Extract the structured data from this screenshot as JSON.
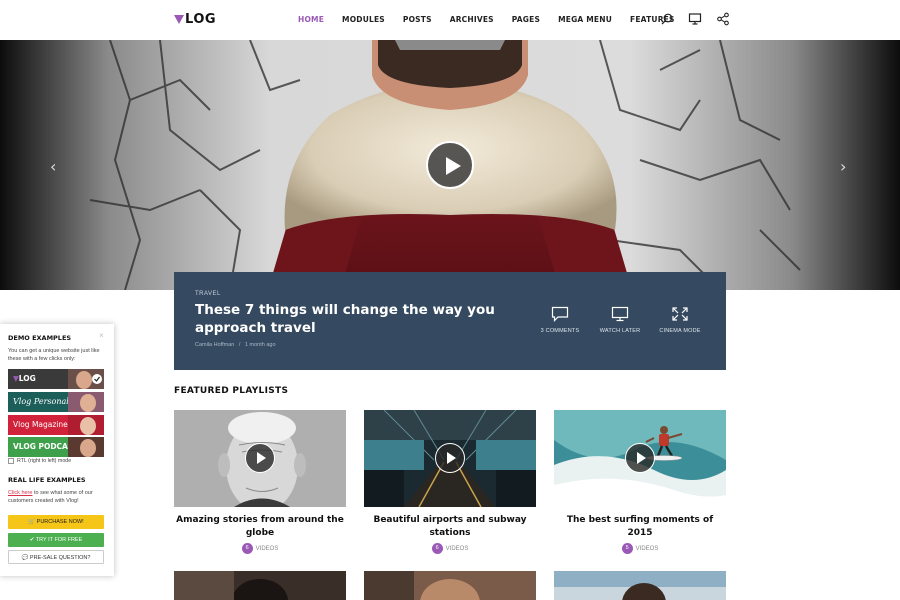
{
  "brand": {
    "logo": "LOG",
    "accent": "#9b59b6"
  },
  "nav": {
    "items": [
      "HOME",
      "MODULES",
      "POSTS",
      "ARCHIVES",
      "PAGES",
      "MEGA MENU",
      "FEATURES"
    ],
    "active": "HOME"
  },
  "header_icons": [
    "search-icon",
    "monitor-icon",
    "share-icon"
  ],
  "hero": {
    "prev": "‹",
    "next": "›"
  },
  "featured_post": {
    "category": "TRAVEL",
    "title": "These 7 things will change the way you approach travel",
    "author": "Camila Hoffman",
    "separator": "/",
    "date": "1 month ago",
    "actions": [
      {
        "icon": "comment-icon",
        "label": "3 COMMENTS"
      },
      {
        "icon": "monitor-icon",
        "label": "WATCH LATER"
      },
      {
        "icon": "expand-icon",
        "label": "CINEMA MODE"
      }
    ]
  },
  "featured_playlists": {
    "heading": "FEATURED PLAYLISTS",
    "items": [
      {
        "title": "Amazing stories from around the globe",
        "count": "6",
        "label": "VIDEOS"
      },
      {
        "title": "Beautiful airports and subway stations",
        "count": "6",
        "label": "VIDEOS"
      },
      {
        "title": "The best surfing moments of 2015",
        "count": "5",
        "label": "VIDEOS"
      }
    ]
  },
  "demo_panel": {
    "close": "×",
    "title": "DEMO EXAMPLES",
    "intro": "You can get a unique website just like these with a few clicks only:",
    "demos": [
      {
        "name": "LOG",
        "color": "#3a3a3a"
      },
      {
        "name": "Vlog Personal",
        "color": "#1b5e5a"
      },
      {
        "name": "Vlog Magazine",
        "color": "#d0223a"
      },
      {
        "name": "VLOG PODCAST",
        "color": "#3ea04a"
      }
    ],
    "rtl_label": "RTL (right to left) mode",
    "real_title": "REAL LIFE EXAMPLES",
    "real_link": "Click here",
    "real_text": " to see what some of our customers created with Vlog!",
    "buttons": {
      "purchase": "PURCHASE NOW!",
      "try": "TRY IT FOR FREE",
      "question": "PRE-SALE QUESTION?"
    }
  }
}
